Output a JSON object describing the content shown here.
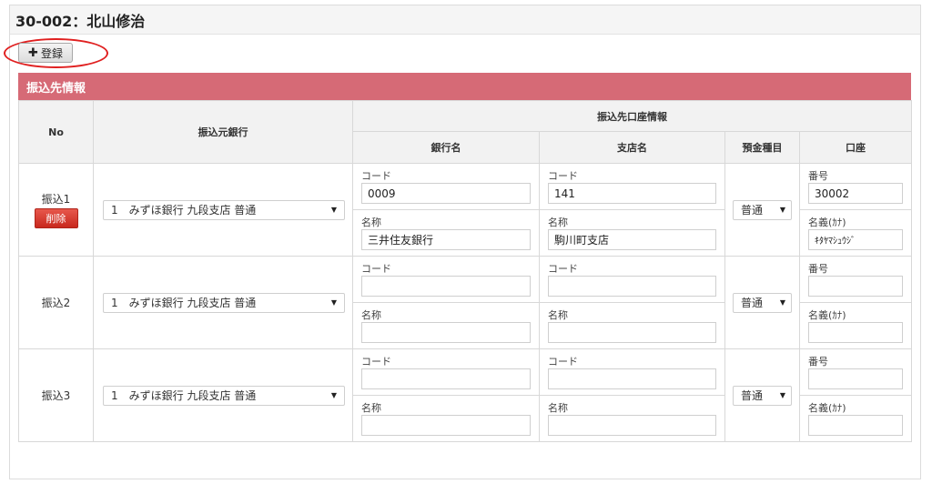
{
  "page": {
    "title": "30-002：北山修治"
  },
  "toolbar": {
    "register_icon": "plus-icon",
    "register_label": "登録"
  },
  "section": {
    "title": "振込先情報"
  },
  "table": {
    "headers": {
      "no": "No",
      "source_bank": "振込元銀行",
      "dest_account_info": "振込先口座情報",
      "bank_name": "銀行名",
      "branch_name": "支店名",
      "deposit_type": "預金種目",
      "account": "口座"
    },
    "rows": [
      {
        "label": "振込1",
        "delete_label": "削除",
        "source_bank": "1　みずほ銀行 九段支店 普通",
        "bank_code_label": "コード",
        "bank_code": "0009",
        "bank_name_label": "名称",
        "bank_name": "三井住友銀行",
        "branch_code_label": "コード",
        "branch_code": "141",
        "branch_name_label": "名称",
        "branch_name": "駒川町支店",
        "deposit_type": "普通",
        "account_number_label": "番号",
        "account_number": "30002",
        "account_holder_label": "名義(ｶﾅ)",
        "account_holder": "ｷﾀﾔﾏｼｭｳｼﾞ"
      },
      {
        "label": "振込2",
        "source_bank": "1　みずほ銀行 九段支店 普通",
        "bank_code_label": "コード",
        "bank_code": "",
        "bank_name_label": "名称",
        "bank_name": "",
        "branch_code_label": "コード",
        "branch_code": "",
        "branch_name_label": "名称",
        "branch_name": "",
        "deposit_type": "普通",
        "account_number_label": "番号",
        "account_number": "",
        "account_holder_label": "名義(ｶﾅ)",
        "account_holder": ""
      },
      {
        "label": "振込3",
        "source_bank": "1　みずほ銀行 九段支店 普通",
        "bank_code_label": "コード",
        "bank_code": "",
        "bank_name_label": "名称",
        "bank_name": "",
        "branch_code_label": "コード",
        "branch_code": "",
        "branch_name_label": "名称",
        "branch_name": "",
        "deposit_type": "普通",
        "account_number_label": "番号",
        "account_number": "",
        "account_holder_label": "名義(ｶﾅ)",
        "account_holder": ""
      }
    ]
  },
  "colors": {
    "section_header": "#d66a76",
    "delete_button": "#d9382c",
    "highlight_circle": "#e02020"
  }
}
